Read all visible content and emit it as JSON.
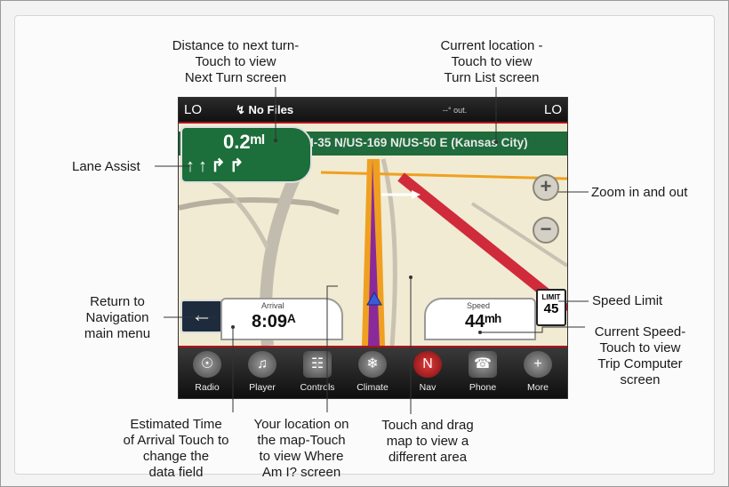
{
  "callouts": {
    "distance": [
      "Distance to next turn-",
      "Touch to view",
      "Next Turn screen"
    ],
    "location": [
      "Current location -",
      "Touch to view",
      "Turn List screen"
    ],
    "lane_assist": [
      "Lane Assist"
    ],
    "zoom": [
      "Zoom in and out"
    ],
    "return": [
      "Return to",
      "Navigation",
      "main menu"
    ],
    "speed_limit": [
      "Speed Limit"
    ],
    "current_speed": [
      "Current Speed-",
      "Touch to view",
      "Trip Computer",
      "screen"
    ],
    "eta": [
      "Estimated Time",
      "of Arrival Touch to",
      "change the",
      "data field"
    ],
    "your_location": [
      "Your location on",
      "the map-Touch",
      "to view Where",
      "Am I? screen"
    ],
    "drag": [
      "Touch and drag",
      "map to view a",
      "different area"
    ]
  },
  "screen": {
    "topbar": {
      "left": "LO",
      "right": "LO",
      "media": "↯ No Files",
      "temp": "--° out."
    },
    "street": "I-35 N/US-169 N/US-50 E (Kansas City)",
    "turn_distance": "0.2ᵐᴵ",
    "lane_arrows": "↑↑↱↱",
    "arrival": {
      "label": "Arrival",
      "value": "8:09ᴬ"
    },
    "speed": {
      "label": "Speed",
      "value": "44ᵐʰ"
    },
    "limit": {
      "label": "LIMIT",
      "value": "45"
    },
    "zoom_in": "+",
    "zoom_out": "−",
    "back": "←",
    "nav": [
      {
        "label": "Radio",
        "icon": "radio-icon",
        "glyph": "☉"
      },
      {
        "label": "Player",
        "icon": "player-icon",
        "glyph": "♫"
      },
      {
        "label": "Controls",
        "icon": "controls-icon",
        "glyph": "☷"
      },
      {
        "label": "Climate",
        "icon": "climate-icon",
        "glyph": "❄"
      },
      {
        "label": "Nav",
        "icon": "nav-icon",
        "glyph": "N"
      },
      {
        "label": "Phone",
        "icon": "phone-icon",
        "glyph": "☎"
      },
      {
        "label": "More",
        "icon": "more-icon",
        "glyph": "+"
      }
    ]
  },
  "colors": {
    "banner": "#1f6b3c",
    "accent": "#b3121b",
    "route": "#8a2a9a",
    "road": "#f0a020"
  }
}
